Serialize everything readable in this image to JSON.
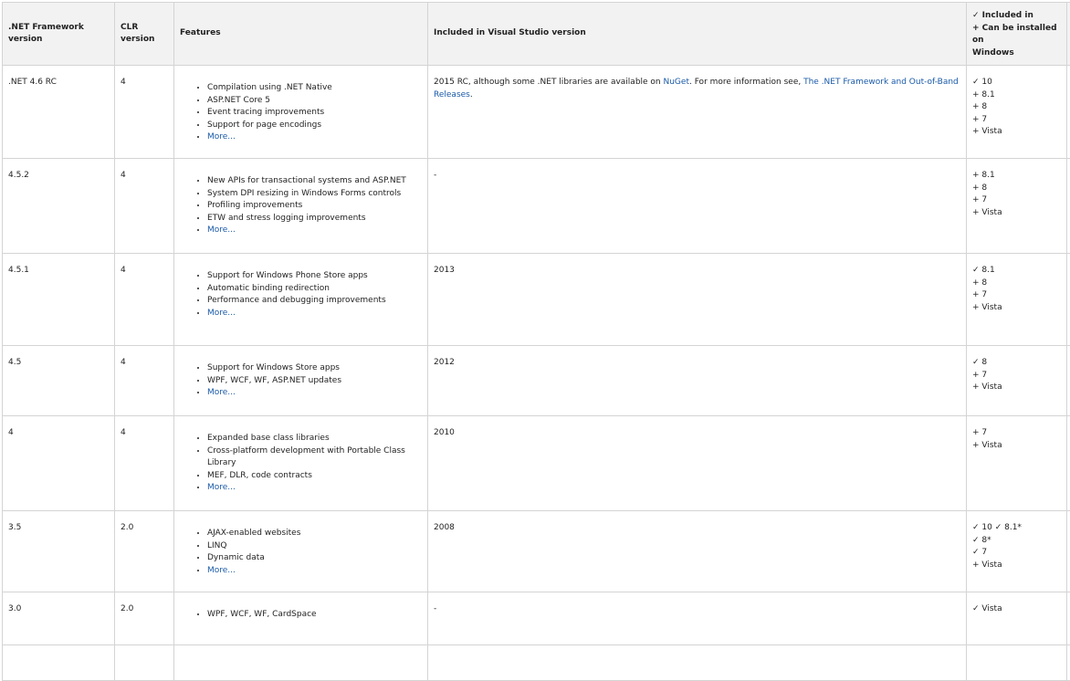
{
  "headers": {
    "framework": ".NET Framework version",
    "clr": "CLR version",
    "features": "Features",
    "vs": "Included in Visual Studio version",
    "windows_included": "✓ Included in",
    "windows_installed": "+ Can be installed on",
    "windows_word": "Windows"
  },
  "more_label": "More...",
  "rows": [
    {
      "framework": ".NET 4.6 RC",
      "clr": "4",
      "features": [
        "Compilation using .NET Native",
        "ASP.NET Core 5",
        "Event tracing improvements",
        "Support for page encodings"
      ],
      "vs_prefix": "2015 RC, although some .NET libraries are available on ",
      "vs_link1": "NuGet",
      "vs_middle": ". For more information see, ",
      "vs_link2": "The .NET Framework and Out-of-Band Releases",
      "vs_suffix": ".",
      "windows": [
        "✓ 10",
        "+ 8.1",
        "+ 8",
        "+ 7",
        "+ Vista"
      ]
    },
    {
      "framework": "4.5.2",
      "clr": "4",
      "features": [
        "New APIs for transactional systems and ASP.NET",
        "System DPI resizing in Windows Forms controls",
        "Profiling improvements",
        "ETW and stress logging improvements"
      ],
      "vs": "-",
      "windows": [
        "+ 8.1",
        "+ 8",
        "+ 7",
        "+ Vista"
      ]
    },
    {
      "framework": "4.5.1",
      "clr": "4",
      "features": [
        "Support for Windows Phone Store apps",
        "Automatic binding redirection",
        "Performance and debugging improvements"
      ],
      "vs": "2013",
      "windows": [
        "✓ 8.1",
        "+ 8",
        "+ 7",
        "+ Vista"
      ]
    },
    {
      "framework": "4.5",
      "clr": "4",
      "features": [
        "Support for Windows Store apps",
        "WPF, WCF, WF, ASP.NET updates"
      ],
      "vs": "2012",
      "windows": [
        "✓ 8",
        "+ 7",
        "+ Vista"
      ]
    },
    {
      "framework": "4",
      "clr": "4",
      "features": [
        "Expanded base class libraries",
        "Cross-platform development with Portable Class Library",
        "MEF, DLR, code contracts"
      ],
      "vs": "2010",
      "windows": [
        "+ 7",
        "+ Vista"
      ]
    },
    {
      "framework": "3.5",
      "clr": "2.0",
      "features": [
        "AJAX-enabled websites",
        "LINQ",
        "Dynamic data"
      ],
      "vs": "2008",
      "windows": [
        "✓ 10 ✓ 8.1*",
        "✓ 8*",
        "✓ 7",
        "+ Vista"
      ]
    },
    {
      "framework": "3.0",
      "clr": "2.0",
      "features": [
        "WPF, WCF, WF, CardSpace"
      ],
      "vs": "-",
      "windows": [
        "✓ Vista"
      ]
    }
  ]
}
